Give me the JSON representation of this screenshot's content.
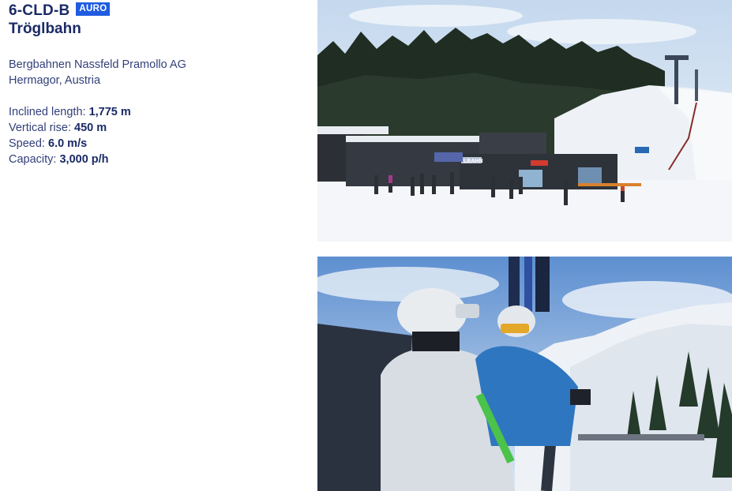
{
  "lift": {
    "code": "6-CLD-B",
    "badge": "AURO",
    "name": "Tröglbahn",
    "operator": "Bergbahnen Nassfeld Pramollo AG",
    "location": "Hermagor, Austria"
  },
  "specs": [
    {
      "label": "Inclined length: ",
      "value": "1,775 m"
    },
    {
      "label": "Vertical rise: ",
      "value": "450 m"
    },
    {
      "label": "Speed: ",
      "value": "6.0 m/s"
    },
    {
      "label": "Capacity: ",
      "value": "3,000 p/h"
    }
  ],
  "station_sign": "LBAHN",
  "colors": {
    "text": "#1a2a66",
    "badge_bg": "#1f5ce0",
    "sky": "#cfe0f1",
    "forest": "#1f2d22",
    "snow": "#f4f6f9"
  }
}
